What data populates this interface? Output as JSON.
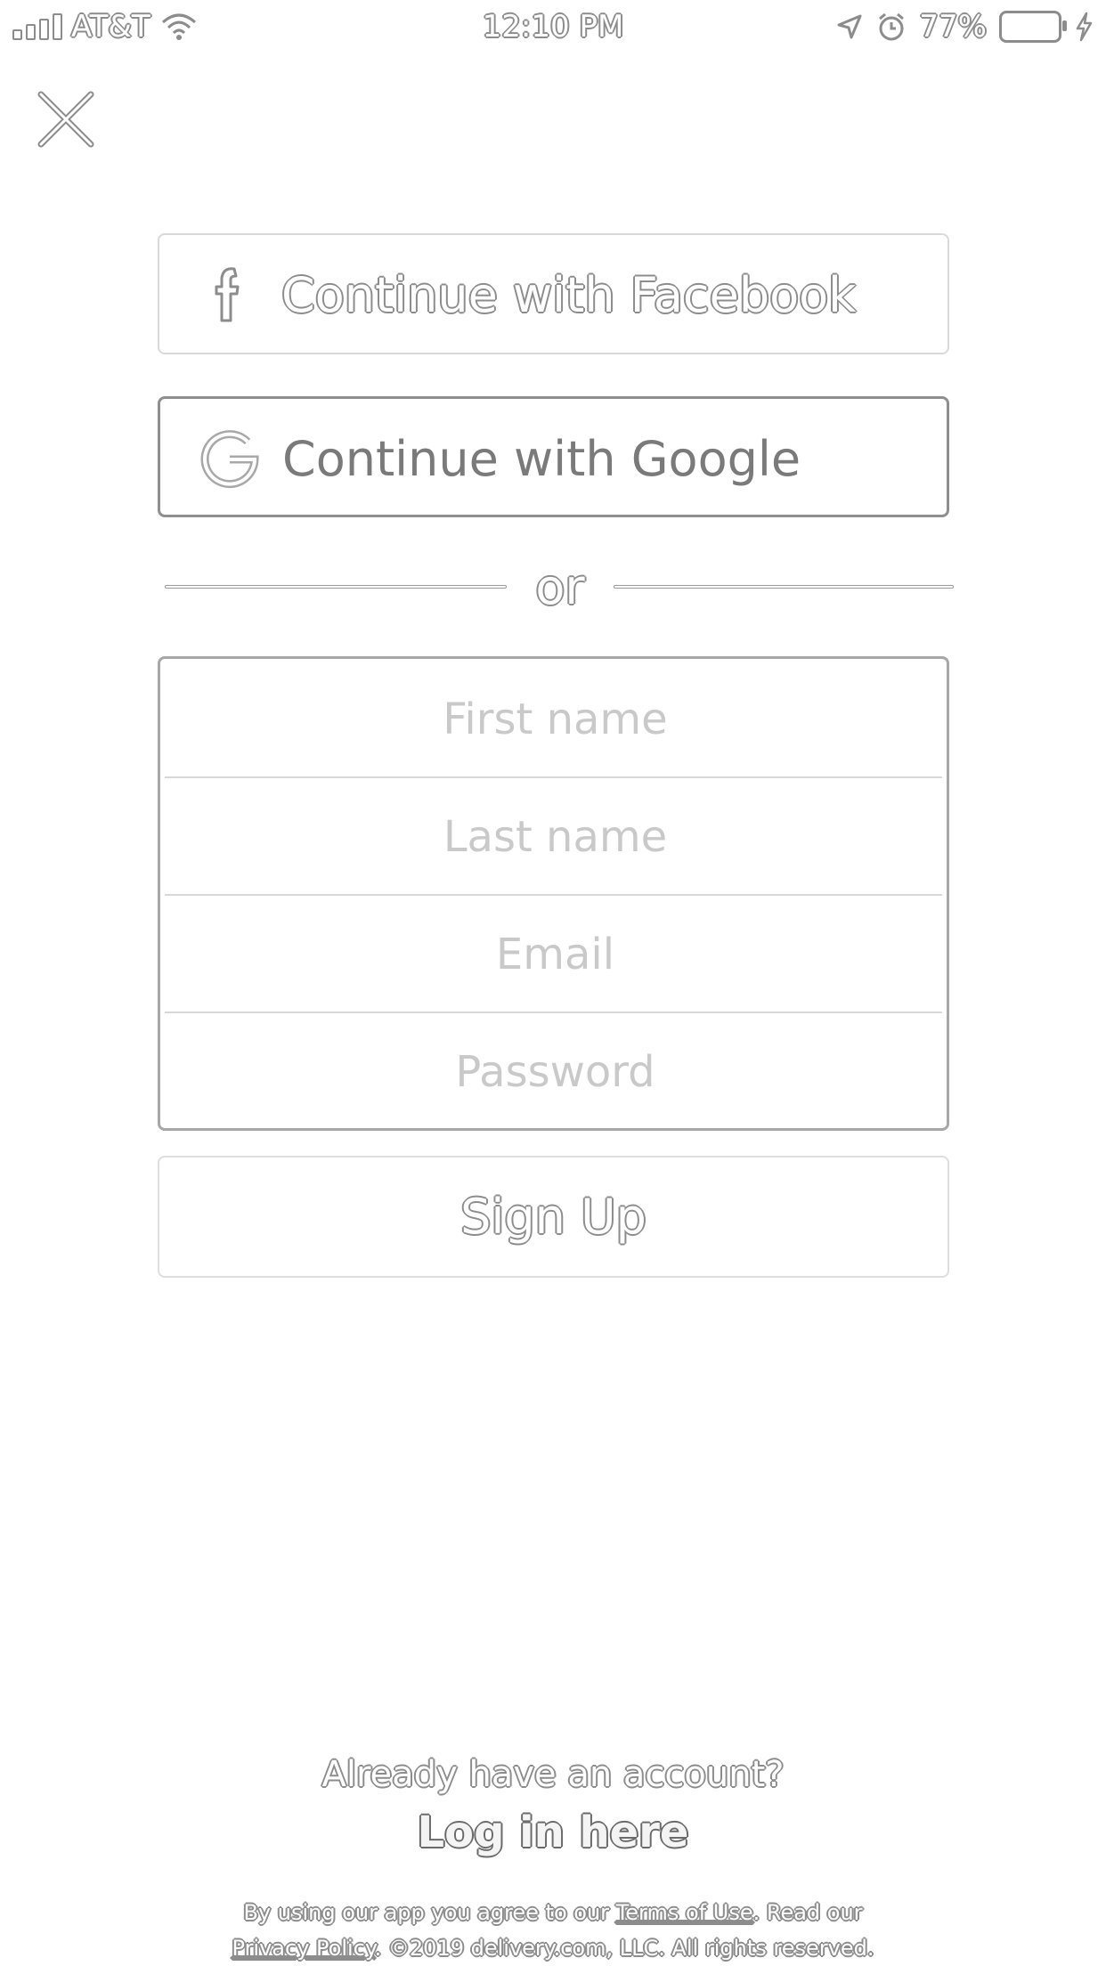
{
  "status_bar": {
    "carrier": "AT&T",
    "time": "12:10 PM",
    "battery": "77%"
  },
  "social": {
    "facebook_label": "Continue with Facebook",
    "google_label": "Continue with Google"
  },
  "divider": {
    "text": "or"
  },
  "form": {
    "first_name_placeholder": "First name",
    "last_name_placeholder": "Last name",
    "email_placeholder": "Email",
    "password_placeholder": "Password"
  },
  "signup": {
    "label": "Sign Up"
  },
  "footer": {
    "already_text": "Already have an account?",
    "login_label": "Log in here",
    "legal_prefix": "By using our app you agree to our",
    "terms_label": "Terms of Use",
    "legal_middle": ". Read our",
    "privacy_label": "Privacy Policy",
    "legal_suffix": ". ©2019 delivery.com, LLC. All rights reserved."
  }
}
